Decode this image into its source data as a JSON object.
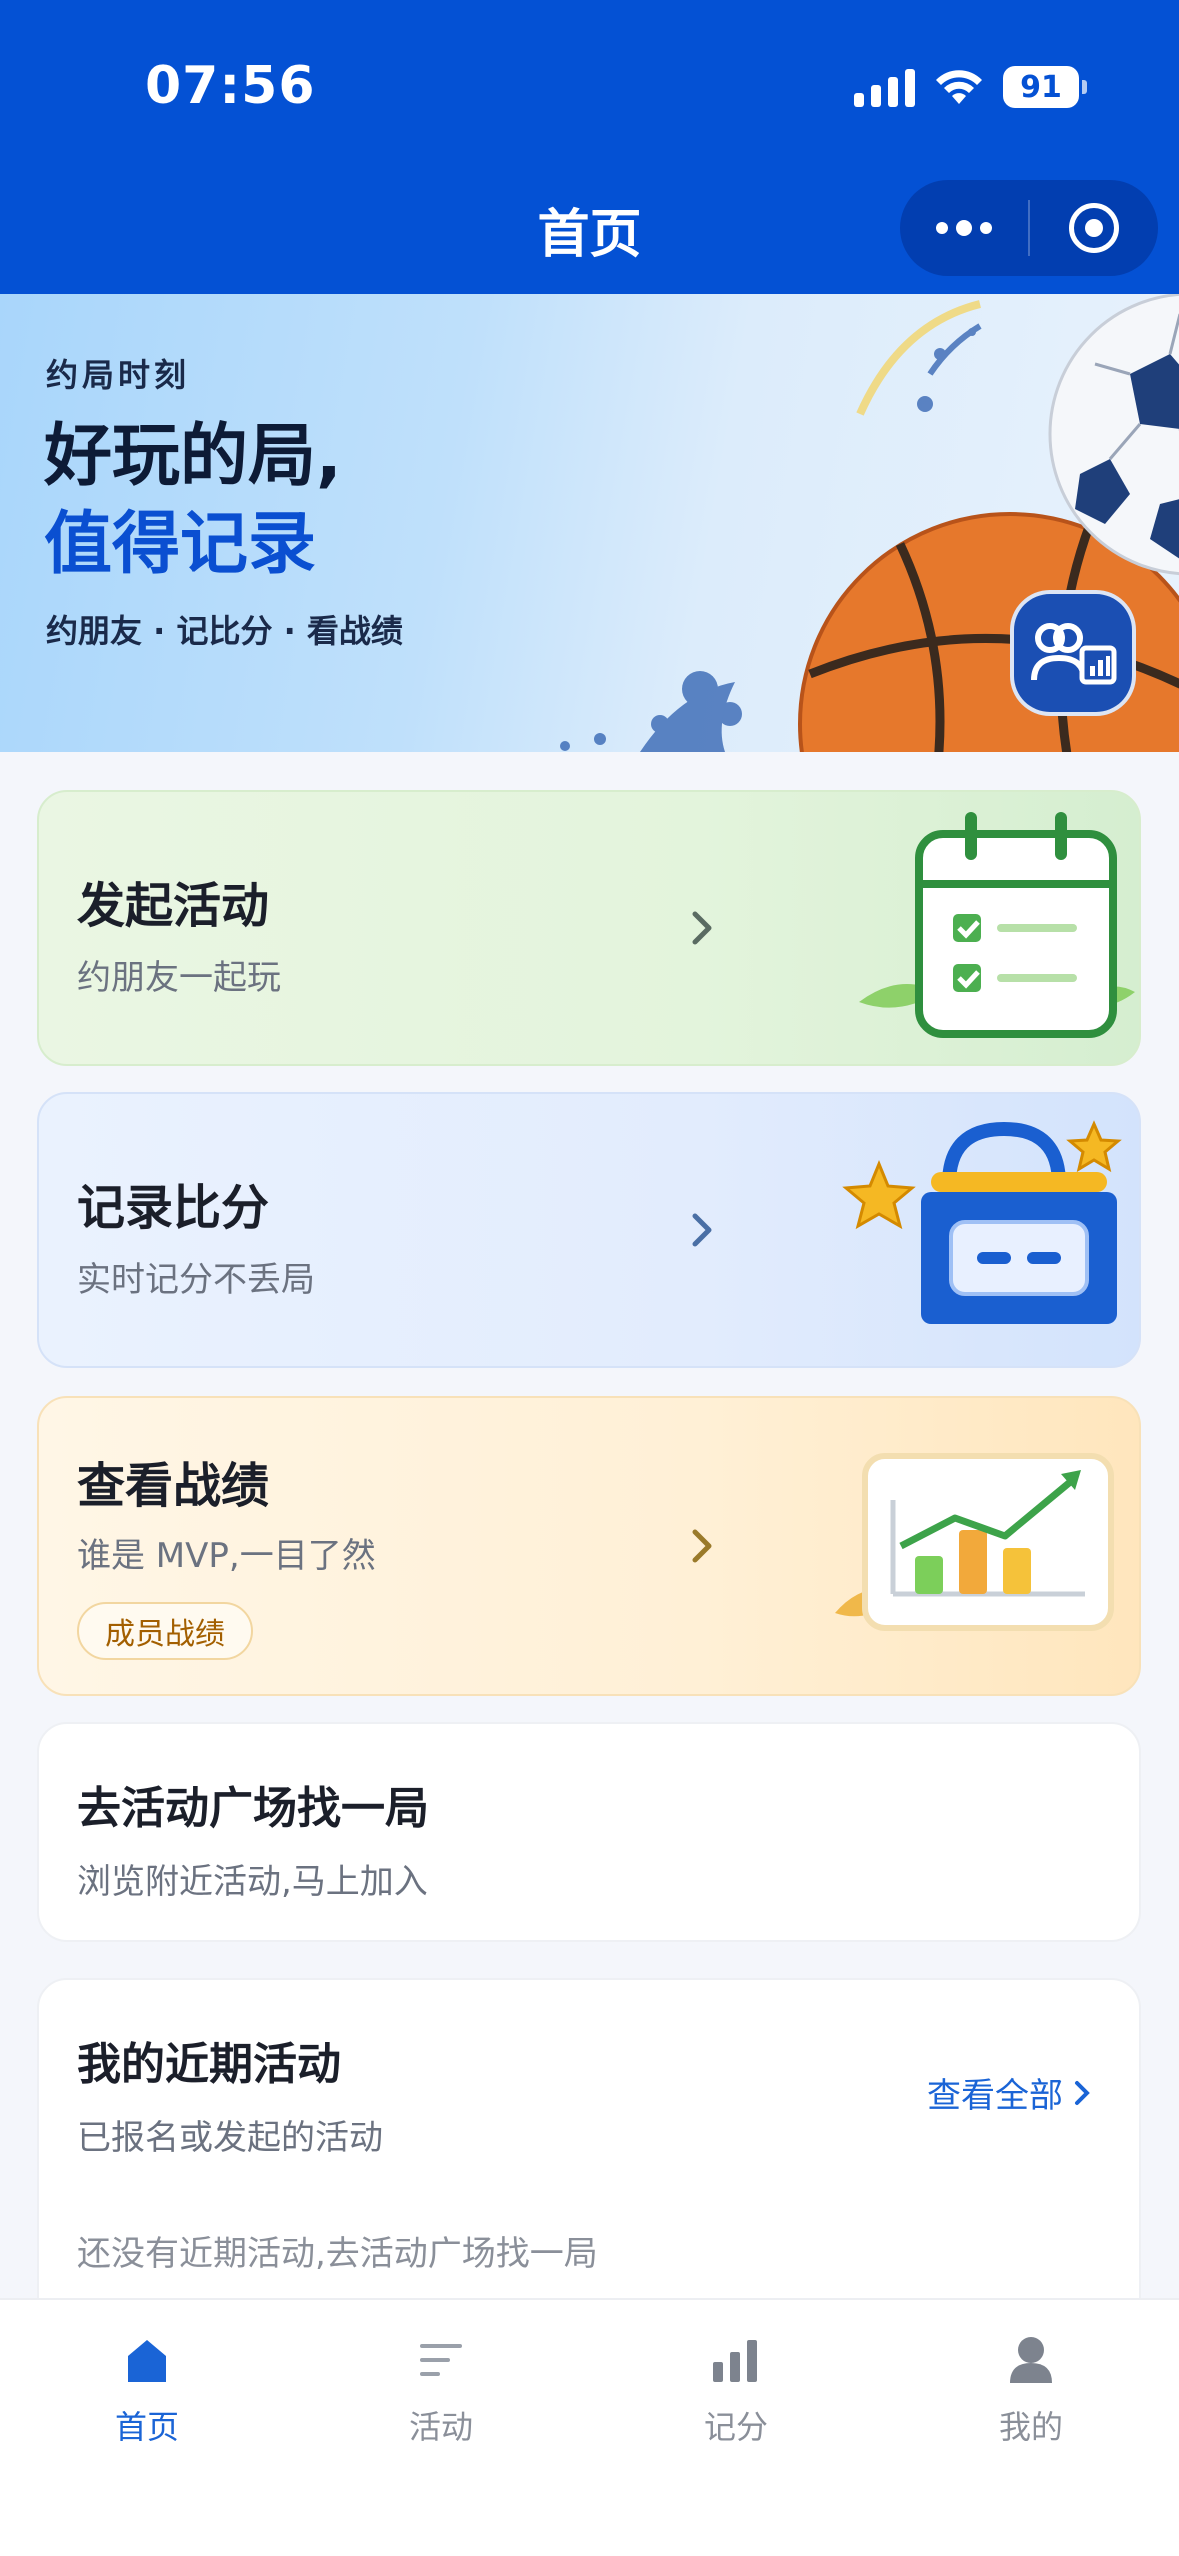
{
  "status_bar": {
    "time": "07:56",
    "battery": "91"
  },
  "header": {
    "title": "首页"
  },
  "banner": {
    "kicker": "约局时刻",
    "headline_line1": "好玩的局,",
    "headline_line2": "值得记录",
    "subline": "约朋友 · 记比分 · 看战绩"
  },
  "features": {
    "create": {
      "title": "发起活动",
      "subtitle": "约朋友一起玩"
    },
    "score": {
      "title": "记录比分",
      "subtitle": "实时记分不丢局"
    },
    "stats": {
      "title": "查看战绩",
      "subtitle": "谁是 MVP,一目了然",
      "tag": "成员战绩"
    }
  },
  "plaza": {
    "title": "去活动广场找一局",
    "subtitle": "浏览附近活动,马上加入"
  },
  "recent": {
    "title": "我的近期活动",
    "subtitle": "已报名或发起的活动",
    "see_all": "查看全部",
    "empty": "还没有近期活动,去活动广场找一局"
  },
  "tabbar": {
    "items": [
      {
        "label": "首页",
        "icon": "home-icon",
        "active": true
      },
      {
        "label": "活动",
        "icon": "list-icon",
        "active": false
      },
      {
        "label": "记分",
        "icon": "bar-chart-icon",
        "active": false
      },
      {
        "label": "我的",
        "icon": "user-icon",
        "active": false
      }
    ]
  },
  "colors": {
    "brand_blue": "#0451d4",
    "link_blue": "#1a64d6",
    "green_card": "#e3f4dc",
    "blue_card": "#e2ecfd",
    "orange_card": "#fff0d6"
  }
}
